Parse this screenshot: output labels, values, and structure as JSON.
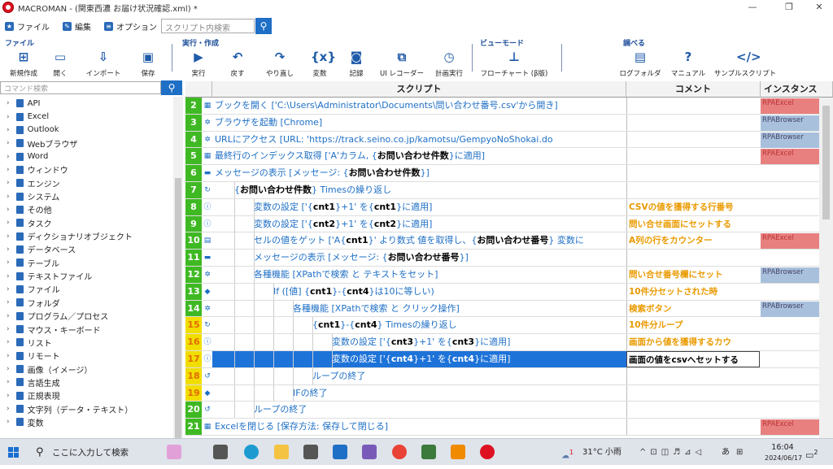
{
  "window": {
    "title": "MACROMAN - (関東西濃 お届け状況確認.xml) *",
    "controls": [
      "—",
      "❐",
      "✕"
    ]
  },
  "menu": [
    {
      "label": "ファイル",
      "icon": "star-icon"
    },
    {
      "label": "編集",
      "icon": "edit-icon"
    },
    {
      "label": "オプション",
      "icon": "options-icon"
    }
  ],
  "script_search": {
    "placeholder": "スクリプト内検索"
  },
  "ribbon": {
    "groups": {
      "file": "ファイル",
      "run": "実行・作成",
      "view": "ビューモード",
      "inspect": "調べる"
    },
    "buttons": [
      {
        "label": "新規作成",
        "icon": "new-file-icon"
      },
      {
        "label": "開く",
        "icon": "open-folder-icon"
      },
      {
        "label": "インポート",
        "icon": "import-icon"
      },
      {
        "label": "保存",
        "icon": "save-icon"
      },
      {
        "label": "実行",
        "icon": "play-icon"
      },
      {
        "label": "戻す",
        "icon": "undo-icon"
      },
      {
        "label": "やり直し",
        "icon": "redo-icon"
      },
      {
        "label": "変数",
        "icon": "variable-icon"
      },
      {
        "label": "記録",
        "icon": "record-icon"
      },
      {
        "label": "UI レコーダー",
        "icon": "ui-recorder-icon"
      },
      {
        "label": "計画実行",
        "icon": "schedule-icon"
      },
      {
        "label": "フローチャート (β版)",
        "icon": "flowchart-icon"
      },
      {
        "label": "ログフォルダ",
        "icon": "log-folder-icon"
      },
      {
        "label": "マニュアル",
        "icon": "help-icon"
      },
      {
        "label": "サンプルスクリプト",
        "icon": "sample-script-icon"
      }
    ]
  },
  "command_search": {
    "placeholder": "コマンド検索"
  },
  "command_tree": [
    "API",
    "Excel",
    "Outlook",
    "Webブラウザ",
    "Word",
    "ウィンドウ",
    "エンジン",
    "システム",
    "その他",
    "タスク",
    "ディクショナリオブジェクト",
    "データベース",
    "テーブル",
    "テキストファイル",
    "ファイル",
    "フォルダ",
    "プログラム／プロセス",
    "マウス・キーボード",
    "リスト",
    "リモート",
    "画像（イメージ）",
    "言語生成",
    "正規表現",
    "文字列（データ・テキスト）",
    "変数"
  ],
  "grid": {
    "headers": {
      "script": "スクリプト",
      "comment": "コメント",
      "instance": "インスタンス"
    },
    "rows": [
      {
        "num": "2",
        "icon": "▦",
        "parts": [
          "ブックを開く ['C:\\Users\\Administrator\\Documents\\問い合わせ番号.csv'から開き]"
        ],
        "comment": "",
        "instance": "RPAExcel"
      },
      {
        "num": "3",
        "icon": "✲",
        "parts": [
          "ブラウザを起動 [Chrome]"
        ],
        "comment": "",
        "instance": "RPABrowser"
      },
      {
        "num": "4",
        "icon": "✲",
        "parts": [
          "URLにアクセス [URL: 'https://track.seino.co.jp/kamotsu/GempyoNoShokai.do"
        ],
        "comment": "",
        "instance": "RPABrowser"
      },
      {
        "num": "5",
        "icon": "▦",
        "parts": [
          "最終行のインデックス取得 ['A'カラム, {",
          "お問い合わせ件数",
          "}に適用]"
        ],
        "comment": "",
        "instance": "RPAExcel"
      },
      {
        "num": "6",
        "icon": "▬",
        "parts": [
          "メッセージの表示 [メッセージ: {",
          "お問い合わせ件数",
          "}]"
        ],
        "comment": "",
        "instance": ""
      },
      {
        "num": "7",
        "icon": "↻",
        "parts": [
          "{",
          "お問い合わせ件数",
          "} Timesの繰り返し"
        ],
        "comment": "",
        "instance": ""
      },
      {
        "num": "8",
        "icon": "ⓘ",
        "parts": [
          "変数の設定 ['{",
          "cnt1",
          "}+1' を{",
          "cnt1",
          "}に適用]"
        ],
        "comment": "CSVの値を獲得する行番号",
        "instance": ""
      },
      {
        "num": "9",
        "icon": "ⓘ",
        "parts": [
          "変数の設定 ['{",
          "cnt2",
          "}+1' を{",
          "cnt2",
          "}に適用]"
        ],
        "comment": "問い合せ画面にセットする",
        "instance": ""
      },
      {
        "num": "10",
        "icon": "▤",
        "parts": [
          "セルの値をゲット ['A{",
          "cnt1",
          "}' より数式 値を取得し、{",
          "お問い合わせ番号",
          "} 変数に"
        ],
        "comment": "A列の行をカウンター",
        "instance": "RPAExcel"
      },
      {
        "num": "11",
        "icon": "▬",
        "parts": [
          "メッセージの表示 [メッセージ: {",
          "お問い合わせ番号",
          "}]"
        ],
        "comment": "",
        "instance": ""
      },
      {
        "num": "12",
        "icon": "✲",
        "parts": [
          "各種機能 [XPathで検索 と テキストをセット]"
        ],
        "comment": "問い合せ番号欄にセット",
        "instance": "RPABrowser"
      },
      {
        "num": "13",
        "icon": "◆",
        "parts": [
          "If ([値] {",
          "cnt1",
          "}-{",
          "cnt4",
          "}は10に等しい)"
        ],
        "comment": "10件分セットされた時",
        "instance": ""
      },
      {
        "num": "14",
        "icon": "✲",
        "parts": [
          "各種機能 [XPathで検索 と クリック操作]"
        ],
        "comment": "検索ボタン",
        "instance": "RPABrowser"
      },
      {
        "num": "15",
        "icon": "↻",
        "parts": [
          "{",
          "cnt1",
          "}-{",
          "cnt4",
          "} Timesの繰り返し"
        ],
        "comment": "10件分ループ",
        "instance": ""
      },
      {
        "num": "16",
        "icon": "ⓘ",
        "parts": [
          "変数の設定 ['{",
          "cnt3",
          "}+1' を{",
          "cnt3",
          "}に適用]"
        ],
        "comment": "画面から値を獲得するカウ",
        "instance": ""
      },
      {
        "num": "17",
        "icon": "ⓘ",
        "parts": [
          "変数の設定 ['{",
          "cnt4",
          "}+1' を{",
          "cnt4",
          "}に適用]"
        ],
        "comment": "画面の値をcsvへセットする",
        "instance": ""
      },
      {
        "num": "18",
        "icon": "↺",
        "parts": [
          "ループの終了"
        ],
        "comment": "",
        "instance": ""
      },
      {
        "num": "19",
        "icon": "◆",
        "parts": [
          "IFの終了"
        ],
        "comment": "",
        "instance": ""
      },
      {
        "num": "20",
        "icon": "↺",
        "parts": [
          "ループの終了"
        ],
        "comment": "",
        "instance": ""
      },
      {
        "num": "21",
        "icon": "▦",
        "parts": [
          "Excelを閉じる [保存方法: 保存して閉じる]"
        ],
        "comment": "",
        "instance": "RPAExcel"
      }
    ]
  },
  "taskbar": {
    "search_placeholder": "ここに入力して検索",
    "weather": "31°C 小雨",
    "weather_badge": "1",
    "time": "16:04",
    "date": "2024/06/17",
    "ime": "あ",
    "notification_count": "2"
  }
}
